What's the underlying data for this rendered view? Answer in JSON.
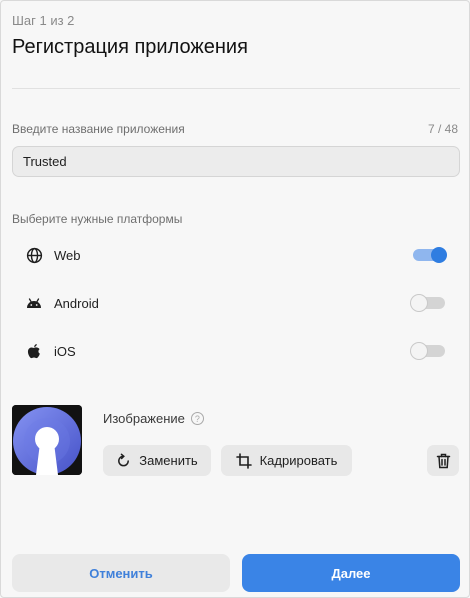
{
  "header": {
    "step": "Шаг 1 из 2",
    "title": "Регистрация приложения"
  },
  "name_field": {
    "label": "Введите название приложения",
    "counter": "7 / 48",
    "value": "Trusted"
  },
  "platforms": {
    "label": "Выберите нужные платформы",
    "items": [
      {
        "label": "Web",
        "icon": "globe-icon",
        "enabled": true
      },
      {
        "label": "Android",
        "icon": "android-icon",
        "enabled": false
      },
      {
        "label": "iOS",
        "icon": "apple-icon",
        "enabled": false
      }
    ]
  },
  "image": {
    "label": "Изображение",
    "help_icon": "question-icon",
    "replace_label": "Заменить",
    "crop_label": "Кадрировать",
    "delete_icon": "trash-icon",
    "preview_icon": "keyhole-icon"
  },
  "footer": {
    "cancel_label": "Отменить",
    "next_label": "Далее"
  },
  "colors": {
    "accent": "#3a84e6",
    "toggle_on_track": "#8fb6ee",
    "icon_gradient_start": "#7f8df0",
    "icon_gradient_end": "#4652c8"
  }
}
